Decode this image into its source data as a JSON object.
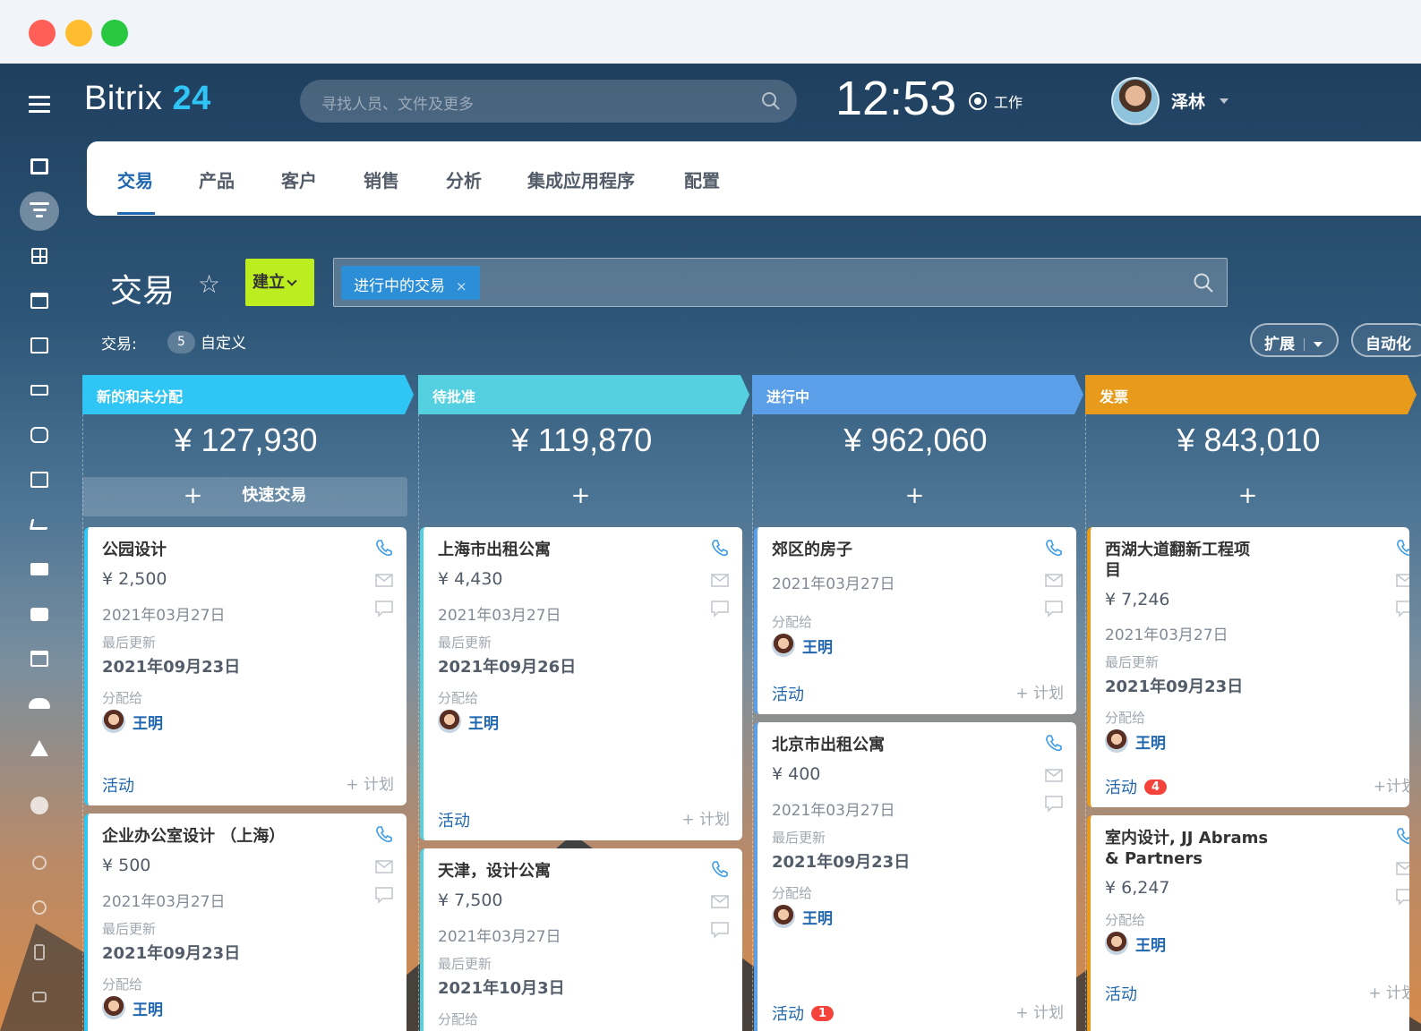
{
  "app": {
    "logo_text": "Bitrix",
    "logo_number": "24",
    "search_placeholder": "寻找人员、文件及更多",
    "clock": "12:53",
    "work_status": "工作",
    "user_name": "泽林"
  },
  "tabs": [
    {
      "label": "交易",
      "active": true
    },
    {
      "label": "产品"
    },
    {
      "label": "客户"
    },
    {
      "label": "销售"
    },
    {
      "label": "分析"
    },
    {
      "label": "集成应用程序"
    },
    {
      "label": "配置"
    }
  ],
  "page": {
    "title": "交易",
    "create_label": "建立",
    "filter_chip": "进行中的交易",
    "counter_label": "交易:",
    "counter_value": "5",
    "counter_text": "自定义",
    "expand_label": "扩展",
    "auto_label": "自动化"
  },
  "labels": {
    "last_updated": "最后更新",
    "assigned": "分配给",
    "activity": "活动",
    "plan": "+ 计划",
    "plan_tight": "+计划",
    "quick_deal": "快速交易"
  },
  "columns": [
    {
      "title": "新的和未分配",
      "color": "#2fc6f6",
      "total": "¥ 127,930"
    },
    {
      "title": "待批准",
      "color": "#55d0e0",
      "total": "¥ 119,870"
    },
    {
      "title": "进行中",
      "color": "#5b9fe8",
      "total": "¥ 962,060"
    },
    {
      "title": "发票",
      "color": "#e89b1a",
      "total": "¥ 843,010"
    }
  ],
  "cards": {
    "c1a": {
      "title": "公园设计",
      "amount": "¥ 2,500",
      "date": "2021年03月27日",
      "updated": "2021年09月23日",
      "person": "王明"
    },
    "c1b": {
      "title": "企业办公室设计 （上海）",
      "amount": "¥ 500",
      "date": "2021年03月27日",
      "updated": "2021年09月23日",
      "person": "王明"
    },
    "c2a": {
      "title": "上海市出租公寓",
      "amount": "¥ 4,430",
      "date": "2021年03月27日",
      "updated": "2021年09月26日",
      "person": "王明"
    },
    "c2b": {
      "title": "天津，设计公寓",
      "amount": "¥ 7,500",
      "date": "2021年03月27日",
      "updated": "2021年10月3日"
    },
    "c3a": {
      "title": "郊区的房子",
      "date": "2021年03月27日",
      "person": "王明"
    },
    "c3b": {
      "title": "北京市出租公寓",
      "amount": "¥ 400",
      "date": "2021年03月27日",
      "updated": "2021年09月23日",
      "person": "王明",
      "activity_badge": "1"
    },
    "c4a": {
      "title": "西湖大道翻新工程项目",
      "amount": "¥ 7,246",
      "date": "2021年03月27日",
      "updated": "2021年09月23日",
      "person": "王明",
      "activity_badge": "4"
    },
    "c4b": {
      "title": "室内设计, JJ Abrams & Partners",
      "amount": "¥ 6,247",
      "person": "王明"
    }
  },
  "icons": {
    "phone": "phone-icon",
    "mail": "mail-icon",
    "comment": "comment-icon",
    "search": "search-icon",
    "star": "star-icon"
  }
}
